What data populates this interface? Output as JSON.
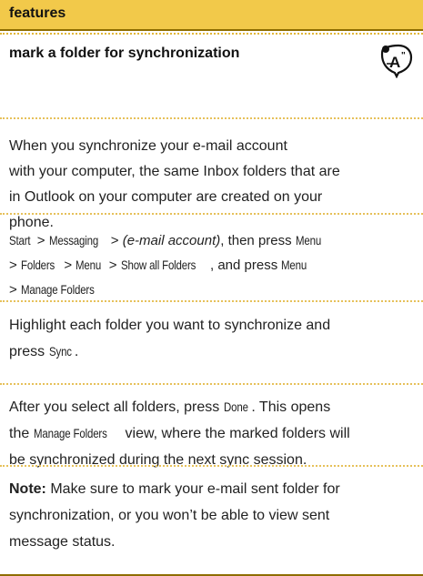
{
  "header": {
    "title": "features"
  },
  "section": {
    "title": "mark a folder for synchronization"
  },
  "intro": {
    "line1": "When you synchronize your e-mail account",
    "line2": "with your computer, the same Inbox folders that are",
    "line3": "in Outlook on your computer are created on your",
    "line4": "phone."
  },
  "navigation": {
    "line1": {
      "k1": "Start",
      "sep1": " > ",
      "k2": "Messaging",
      "sep2": " > ",
      "em": "(e-mail account)",
      "txt": ", then press ",
      "k3": "Menu"
    },
    "line2": {
      "sep1": "> ",
      "k1": "Folders",
      "sep2": " > ",
      "k2": "Menu",
      "sep3": " > ",
      "k3": "Show all Folders",
      "txt": ", and press ",
      "k4": "Menu"
    },
    "line3": {
      "sep1": "> ",
      "k1": "Manage Folders"
    }
  },
  "highlight": {
    "line1": "Highlight each folder you want to synchronize and",
    "line2_pre": "press ",
    "line2_key": "Sync",
    "line2_post": "."
  },
  "after": {
    "line1_pre": "After you select all folders, press ",
    "line1_key": "Done",
    "line1_post": ". This opens",
    "line2_pre": "the ",
    "line2_key": "Manage Folders",
    "line2_post": " view, where the marked folders will",
    "line3": "be synchronized during the next sync session."
  },
  "note": {
    "label": "Note:",
    "line1": " Make sure to mark your e-mail sent folder for",
    "line2": "synchronization, or you won’t be able to view sent",
    "line3": "message status."
  },
  "colors": {
    "header_bg": "#f2c94a",
    "accent_border": "#8e6d00",
    "note_label": "#2aa5d6"
  },
  "icons": {
    "feature_icon": "network-dependent-feature-icon"
  }
}
